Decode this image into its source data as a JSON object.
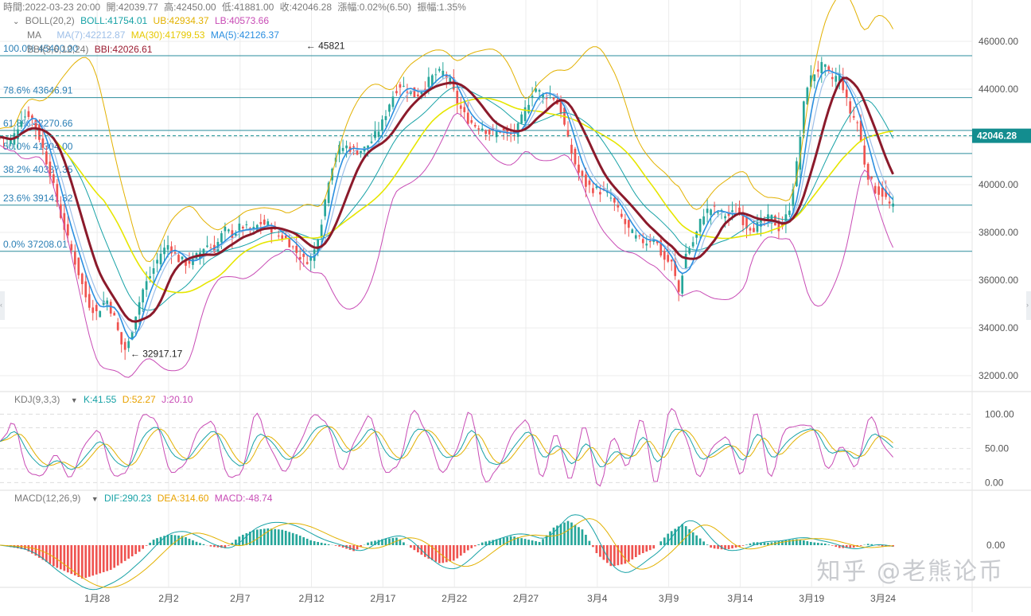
{
  "header": {
    "time_label": "時間:2022-03-23 20:00",
    "open_label": "開:42039.77",
    "high_label": "高:42450.00",
    "low_label": "低:41881.00",
    "close_label": "收:42046.28",
    "change_label": "漲幅:0.02%(6.50)",
    "amplitude_label": "振幅:1.35%"
  },
  "indicators": {
    "boll": {
      "name": "BOLL(20,2)",
      "boll": "BOLL:41754.01",
      "ub": "UB:42934.37",
      "lb": "LB:40573.66"
    },
    "ma": {
      "name": "MA",
      "ma7": "MA(7):42212.87",
      "ma30": "MA(30):41799.53",
      "ma5": "MA(5):42126.37"
    },
    "bbi": {
      "name": "BBI(3,6,12,24)",
      "value": "BBI:42026.61"
    },
    "kdj": {
      "name": "KDJ(9,3,3)",
      "k": "K:41.55",
      "d": "D:52.27",
      "j": "J:20.10"
    },
    "macd": {
      "name": "MACD(12,26,9)",
      "dif": "DIF:290.23",
      "dea": "DEA:314.60",
      "macd": "MACD:-48.74"
    }
  },
  "colors": {
    "up": "#26a69a",
    "down": "#ef5350",
    "boll": "#17a2a6",
    "ub": "#e2b100",
    "lb": "#c84bb5",
    "ma5": "#2b8fe0",
    "ma7": "#9dbfe8",
    "ma30": "#e6e600",
    "bbi": "#8b1a2b",
    "fib": "#2a8c9c",
    "last_price_bg": "#138d8f",
    "axis_text": "#555555",
    "grid": "#ececec"
  },
  "watermark": "知乎 @老熊论币",
  "chart_data": {
    "type": "candlestick",
    "price_axis": {
      "ticks": [
        32000,
        34000,
        36000,
        38000,
        40000,
        42000,
        44000,
        46000
      ],
      "tick_labels": [
        "32000.00",
        "34000.00",
        "36000.00",
        "38000.00",
        "40000.00",
        "42000.00",
        "44000.00",
        "46000.00"
      ],
      "range": [
        31400,
        47400
      ]
    },
    "kdj_axis": {
      "ticks": [
        0,
        50,
        100
      ],
      "tick_labels": [
        "0.00",
        "50.00",
        "100.00"
      ],
      "range": [
        -10,
        112
      ]
    },
    "macd_axis": {
      "ticks": [
        0
      ],
      "tick_labels": [
        "0.00"
      ]
    },
    "x_tick_labels": [
      "1月28",
      "2月2",
      "2月7",
      "2月12",
      "2月17",
      "2月22",
      "2月27",
      "3月4",
      "3月9",
      "3月14",
      "3月19",
      "3月24"
    ],
    "x_tick_days": [
      28,
      33,
      38,
      43,
      48,
      53,
      58,
      63,
      68,
      73,
      78,
      83
    ],
    "x_range_days": [
      21.2,
      84.0
    ],
    "last_price": {
      "value": 42046.28,
      "label": "42046.28"
    },
    "fib_levels": [
      {
        "label": "100.0% 45400.00",
        "value": 45400.0
      },
      {
        "label": "78.6% 43646.91",
        "value": 43646.91
      },
      {
        "label": "61.8% 42270.66",
        "value": 42270.66
      },
      {
        "label": "50.0% 41304.00",
        "value": 41304.0
      },
      {
        "label": "38.2% 40337.35",
        "value": 40337.35
      },
      {
        "label": "23.6% 39141.32",
        "value": 39141.32
      },
      {
        "label": "0.0% 37208.01",
        "value": 37208.01
      }
    ],
    "annotations": [
      {
        "label": "45821",
        "day": 42.4,
        "value": 45821
      },
      {
        "label": "32917.17",
        "day": 30.1,
        "value": 32917.17
      }
    ],
    "price_path": [
      [
        21.2,
        42000
      ],
      [
        22.0,
        41800
      ],
      [
        22.7,
        42800
      ],
      [
        23.3,
        43000
      ],
      [
        24.0,
        41900
      ],
      [
        24.7,
        40500
      ],
      [
        25.4,
        38800
      ],
      [
        26.0,
        37600
      ],
      [
        26.7,
        36300
      ],
      [
        27.3,
        35100
      ],
      [
        28.0,
        34600
      ],
      [
        28.6,
        35300
      ],
      [
        29.2,
        34400
      ],
      [
        29.8,
        33100
      ],
      [
        30.1,
        33100
      ],
      [
        30.6,
        34400
      ],
      [
        31.2,
        35600
      ],
      [
        31.8,
        36300
      ],
      [
        32.4,
        37100
      ],
      [
        33.0,
        37500
      ],
      [
        33.6,
        36900
      ],
      [
        34.3,
        36700
      ],
      [
        35.0,
        37000
      ],
      [
        35.6,
        37500
      ],
      [
        36.2,
        37300
      ],
      [
        36.9,
        38100
      ],
      [
        37.5,
        37900
      ],
      [
        38.1,
        38300
      ],
      [
        38.8,
        38000
      ],
      [
        39.4,
        38400
      ],
      [
        40.0,
        38300
      ],
      [
        40.6,
        37900
      ],
      [
        41.3,
        37700
      ],
      [
        41.9,
        37200
      ],
      [
        42.5,
        36800
      ],
      [
        43.1,
        37000
      ],
      [
        43.7,
        38500
      ],
      [
        44.3,
        40600
      ],
      [
        44.9,
        41500
      ],
      [
        45.5,
        41600
      ],
      [
        46.1,
        41400
      ],
      [
        46.7,
        41500
      ],
      [
        47.3,
        41900
      ],
      [
        47.9,
        42500
      ],
      [
        48.5,
        43500
      ],
      [
        49.1,
        44200
      ],
      [
        49.7,
        44000
      ],
      [
        50.3,
        43700
      ],
      [
        51.0,
        44200
      ],
      [
        51.6,
        44600
      ],
      [
        52.2,
        44700
      ],
      [
        52.7,
        44300
      ],
      [
        53.2,
        43400
      ],
      [
        53.8,
        42800
      ],
      [
        54.4,
        42500
      ],
      [
        55.0,
        42400
      ],
      [
        55.6,
        42100
      ],
      [
        56.2,
        42300
      ],
      [
        56.8,
        42000
      ],
      [
        57.4,
        42300
      ],
      [
        58.0,
        43200
      ],
      [
        58.6,
        44100
      ],
      [
        59.2,
        43700
      ],
      [
        59.8,
        43800
      ],
      [
        60.4,
        43200
      ],
      [
        61.0,
        41700
      ],
      [
        61.6,
        40600
      ],
      [
        62.2,
        40000
      ],
      [
        62.8,
        39800
      ],
      [
        63.4,
        39700
      ],
      [
        64.0,
        39400
      ],
      [
        64.6,
        38700
      ],
      [
        65.2,
        38100
      ],
      [
        65.8,
        37700
      ],
      [
        66.4,
        37600
      ],
      [
        67.0,
        37800
      ],
      [
        67.6,
        36900
      ],
      [
        68.2,
        36700
      ],
      [
        68.7,
        35500
      ],
      [
        69.2,
        37100
      ],
      [
        69.8,
        37700
      ],
      [
        70.4,
        38800
      ],
      [
        71.0,
        39000
      ],
      [
        71.6,
        38800
      ],
      [
        72.2,
        38700
      ],
      [
        72.8,
        38900
      ],
      [
        73.4,
        38300
      ],
      [
        74.0,
        38200
      ],
      [
        74.6,
        38500
      ],
      [
        75.2,
        38600
      ],
      [
        75.8,
        38100
      ],
      [
        76.4,
        38900
      ],
      [
        77.0,
        41000
      ],
      [
        77.6,
        44100
      ],
      [
        78.2,
        44700
      ],
      [
        78.8,
        45000
      ],
      [
        79.4,
        44400
      ],
      [
        80.0,
        44600
      ],
      [
        80.6,
        43100
      ],
      [
        81.2,
        42600
      ],
      [
        81.8,
        40600
      ],
      [
        82.4,
        39800
      ],
      [
        83.0,
        39600
      ],
      [
        83.6,
        39000
      ],
      [
        84.0,
        39100
      ]
    ],
    "kdj_path": [
      [
        21.2,
        60
      ],
      [
        22.0,
        80
      ],
      [
        23.0,
        40
      ],
      [
        24.0,
        20
      ],
      [
        25.0,
        35
      ],
      [
        26.0,
        15
      ],
      [
        27.0,
        40
      ],
      [
        28.0,
        65
      ],
      [
        29.0,
        30
      ],
      [
        30.0,
        20
      ],
      [
        31.0,
        70
      ],
      [
        32.0,
        85
      ],
      [
        33.0,
        40
      ],
      [
        34.0,
        30
      ],
      [
        35.0,
        60
      ],
      [
        36.0,
        80
      ],
      [
        37.0,
        35
      ],
      [
        38.0,
        20
      ],
      [
        39.0,
        75
      ],
      [
        40.0,
        60
      ],
      [
        41.0,
        30
      ],
      [
        42.0,
        45
      ],
      [
        43.0,
        80
      ],
      [
        44.0,
        85
      ],
      [
        45.0,
        40
      ],
      [
        46.0,
        55
      ],
      [
        47.0,
        85
      ],
      [
        48.0,
        40
      ],
      [
        49.0,
        30
      ],
      [
        50.0,
        80
      ],
      [
        51.0,
        75
      ],
      [
        52.0,
        35
      ],
      [
        53.0,
        40
      ],
      [
        54.0,
        85
      ],
      [
        55.0,
        30
      ],
      [
        56.0,
        25
      ],
      [
        57.0,
        55
      ],
      [
        58.0,
        80
      ],
      [
        59.0,
        30
      ],
      [
        60.0,
        60
      ],
      [
        61.0,
        20
      ],
      [
        62.0,
        65
      ],
      [
        63.0,
        15
      ],
      [
        64.0,
        50
      ],
      [
        65.0,
        30
      ],
      [
        66.0,
        75
      ],
      [
        67.0,
        20
      ],
      [
        68.0,
        80
      ],
      [
        69.0,
        75
      ],
      [
        70.0,
        30
      ],
      [
        71.0,
        45
      ],
      [
        72.0,
        60
      ],
      [
        73.0,
        25
      ],
      [
        74.0,
        80
      ],
      [
        75.0,
        30
      ],
      [
        76.0,
        60
      ],
      [
        77.0,
        75
      ],
      [
        78.0,
        80
      ],
      [
        79.0,
        40
      ],
      [
        80.0,
        50
      ],
      [
        81.0,
        30
      ],
      [
        82.0,
        75
      ],
      [
        83.0,
        60
      ],
      [
        84.0,
        40
      ]
    ],
    "macd_path": [
      [
        21.2,
        0
      ],
      [
        23.0,
        -150
      ],
      [
        25.0,
        -700
      ],
      [
        27.0,
        -1100
      ],
      [
        29.0,
        -800
      ],
      [
        31.0,
        -200
      ],
      [
        32.0,
        200
      ],
      [
        33.0,
        350
      ],
      [
        34.0,
        300
      ],
      [
        35.0,
        100
      ],
      [
        36.0,
        -50
      ],
      [
        37.0,
        -100
      ],
      [
        38.0,
        300
      ],
      [
        39.0,
        500
      ],
      [
        40.0,
        550
      ],
      [
        41.0,
        500
      ],
      [
        42.0,
        350
      ],
      [
        43.0,
        150
      ],
      [
        44.0,
        50
      ],
      [
        45.0,
        -50
      ],
      [
        46.0,
        -200
      ],
      [
        47.0,
        100
      ],
      [
        48.0,
        200
      ],
      [
        49.0,
        250
      ],
      [
        50.0,
        -100
      ],
      [
        51.0,
        -400
      ],
      [
        52.0,
        -600
      ],
      [
        53.0,
        -500
      ],
      [
        54.0,
        -150
      ],
      [
        55.0,
        100
      ],
      [
        56.0,
        200
      ],
      [
        57.0,
        300
      ],
      [
        58.0,
        200
      ],
      [
        59.0,
        100
      ],
      [
        60.0,
        600
      ],
      [
        61.0,
        800
      ],
      [
        62.0,
        500
      ],
      [
        63.0,
        -300
      ],
      [
        64.0,
        -700
      ],
      [
        65.0,
        -600
      ],
      [
        66.0,
        -300
      ],
      [
        67.0,
        -100
      ],
      [
        68.0,
        400
      ],
      [
        69.0,
        700
      ],
      [
        70.0,
        300
      ],
      [
        71.0,
        -100
      ],
      [
        72.0,
        -150
      ],
      [
        73.0,
        -50
      ],
      [
        74.0,
        100
      ],
      [
        75.0,
        80
      ],
      [
        76.0,
        150
      ],
      [
        77.0,
        200
      ],
      [
        78.0,
        100
      ],
      [
        79.0,
        50
      ],
      [
        80.0,
        -100
      ],
      [
        81.0,
        -80
      ],
      [
        82.0,
        50
      ],
      [
        83.0,
        -40
      ],
      [
        84.0,
        -48.74
      ]
    ]
  }
}
